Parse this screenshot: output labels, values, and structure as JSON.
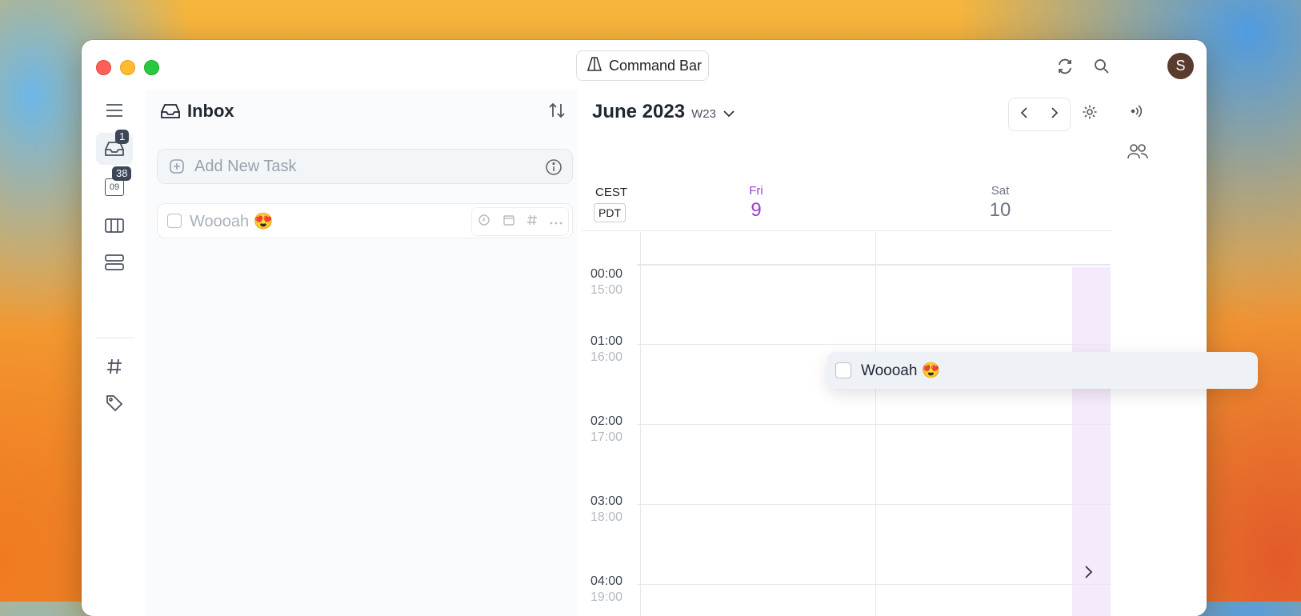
{
  "window": {
    "command_bar_label": "Command Bar",
    "avatar_initial": "S"
  },
  "rail": {
    "inbox_badge": "1",
    "today_badge": "38",
    "today_date": "09"
  },
  "inbox": {
    "title": "Inbox",
    "add_placeholder": "Add New Task",
    "tasks": [
      {
        "title": "Woooah 😍",
        "done": false
      }
    ]
  },
  "calendar": {
    "month": "June 2023",
    "week": "W23",
    "tz_primary": "CEST",
    "tz_secondary": "PDT",
    "days": [
      {
        "dow": "Fri",
        "num": "9",
        "color": "#9b3fcf"
      },
      {
        "dow": "Sat",
        "num": "10",
        "color": "#6b7380"
      }
    ],
    "hours": [
      {
        "primary": "00:00",
        "secondary": "15:00"
      },
      {
        "primary": "01:00",
        "secondary": "16:00"
      },
      {
        "primary": "02:00",
        "secondary": "17:00"
      },
      {
        "primary": "03:00",
        "secondary": "18:00"
      },
      {
        "primary": "04:00",
        "secondary": "19:00"
      }
    ]
  },
  "drag_task": {
    "title": "Woooah 😍"
  }
}
